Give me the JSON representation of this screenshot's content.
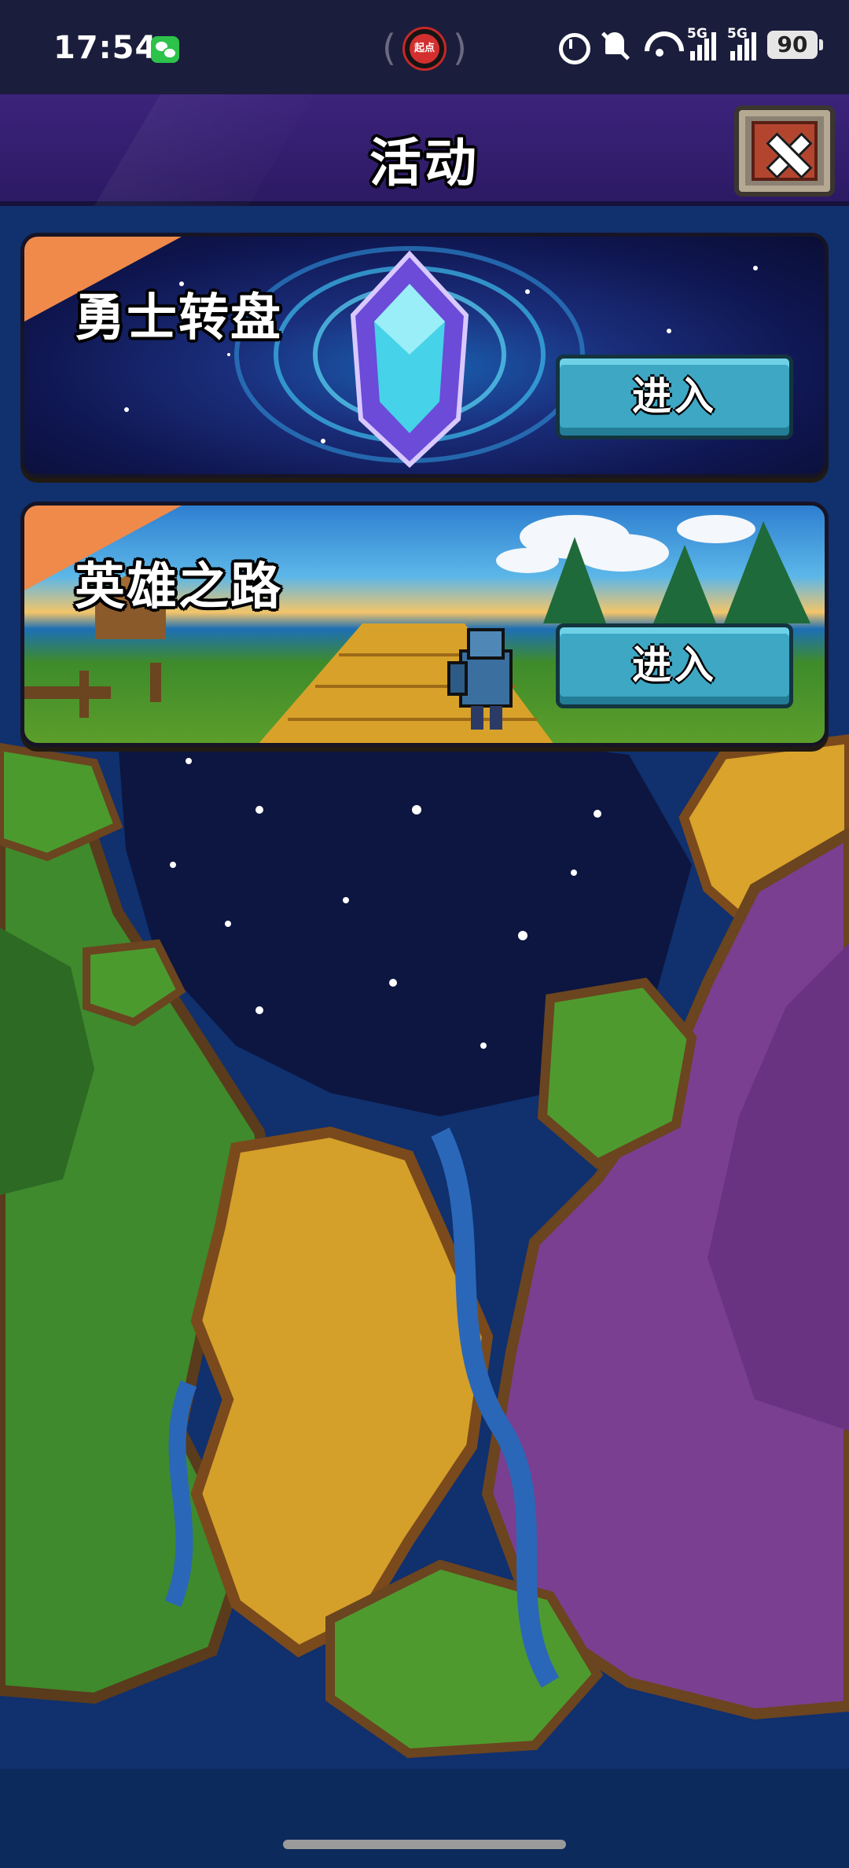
{
  "status_bar": {
    "time": "17:54",
    "app_badge": "起点",
    "network_1": "5G",
    "network_2": "5G",
    "battery": "90"
  },
  "header": {
    "title": "活动"
  },
  "activities": [
    {
      "title": "勇士转盘",
      "button_label": "进入"
    },
    {
      "title": "英雄之路",
      "button_label": "进入"
    }
  ],
  "colors": {
    "header_bg": "#3c237b",
    "corner_tag": "#f08a4b",
    "enter_button": "#3da7c4",
    "close_button": "#b3452f"
  },
  "icons": [
    "wechat-icon",
    "alarm-icon",
    "mute-bell-icon",
    "wifi-icon",
    "signal-icon",
    "battery-icon",
    "close-icon"
  ]
}
